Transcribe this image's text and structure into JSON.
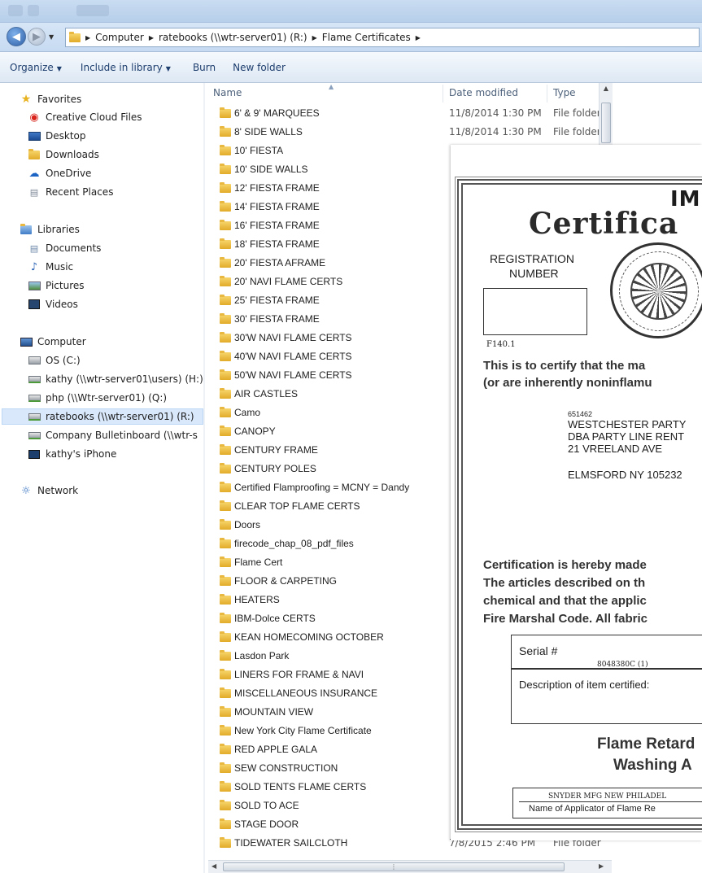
{
  "address_bar": {
    "crumbs": [
      "Computer",
      "ratebooks (\\\\wtr-server01) (R:)",
      "Flame Certificates"
    ]
  },
  "toolbar": {
    "organize": "Organize",
    "include_in_library": "Include in library",
    "burn": "Burn",
    "new_folder": "New folder"
  },
  "nav": {
    "favorites": {
      "label": "Favorites",
      "items": [
        "Creative Cloud Files",
        "Desktop",
        "Downloads",
        "OneDrive",
        "Recent Places"
      ]
    },
    "libraries": {
      "label": "Libraries",
      "items": [
        "Documents",
        "Music",
        "Pictures",
        "Videos"
      ]
    },
    "computer": {
      "label": "Computer",
      "items": [
        "OS (C:)",
        "kathy (\\\\wtr-server01\\users) (H:)",
        "php (\\\\Wtr-server01) (Q:)",
        "ratebooks (\\\\wtr-server01) (R:)",
        "Company Bulletinboard (\\\\wtr-s",
        "kathy's iPhone"
      ]
    },
    "network": {
      "label": "Network"
    }
  },
  "columns": {
    "name": "Name",
    "date_modified": "Date modified",
    "type": "Type"
  },
  "files": [
    {
      "name": "6' & 9' MARQUEES",
      "date": "11/8/2014 1:30 PM",
      "type": "File folder"
    },
    {
      "name": "8' SIDE WALLS",
      "date": "11/8/2014 1:30 PM",
      "type": "File folder"
    },
    {
      "name": "10' FIESTA",
      "date": "",
      "type": ""
    },
    {
      "name": "10' SIDE WALLS",
      "date": "",
      "type": ""
    },
    {
      "name": "12' FIESTA FRAME",
      "date": "",
      "type": ""
    },
    {
      "name": "14' FIESTA FRAME",
      "date": "",
      "type": ""
    },
    {
      "name": "16' FIESTA FRAME",
      "date": "",
      "type": ""
    },
    {
      "name": "18' FIESTA FRAME",
      "date": "",
      "type": ""
    },
    {
      "name": "20' FIESTA AFRAME",
      "date": "",
      "type": ""
    },
    {
      "name": "20' NAVI FLAME CERTS",
      "date": "",
      "type": ""
    },
    {
      "name": "25' FIESTA FRAME",
      "date": "",
      "type": ""
    },
    {
      "name": "30' FIESTA FRAME",
      "date": "",
      "type": ""
    },
    {
      "name": "30'W NAVI FLAME CERTS",
      "date": "",
      "type": ""
    },
    {
      "name": "40'W NAVI FLAME CERTS",
      "date": "",
      "type": ""
    },
    {
      "name": "50'W NAVI FLAME CERTS",
      "date": "",
      "type": ""
    },
    {
      "name": "AIR CASTLES",
      "date": "",
      "type": ""
    },
    {
      "name": "Camo",
      "date": "",
      "type": ""
    },
    {
      "name": "CANOPY",
      "date": "",
      "type": ""
    },
    {
      "name": "CENTURY FRAME",
      "date": "",
      "type": ""
    },
    {
      "name": "CENTURY POLES",
      "date": "",
      "type": ""
    },
    {
      "name": "Certified Flamproofing = MCNY = Dandy",
      "date": "",
      "type": ""
    },
    {
      "name": "CLEAR TOP FLAME CERTS",
      "date": "",
      "type": ""
    },
    {
      "name": "Doors",
      "date": "",
      "type": ""
    },
    {
      "name": "firecode_chap_08_pdf_files",
      "date": "",
      "type": ""
    },
    {
      "name": "Flame Cert",
      "date": "",
      "type": ""
    },
    {
      "name": "FLOOR & CARPETING",
      "date": "",
      "type": ""
    },
    {
      "name": "HEATERS",
      "date": "",
      "type": ""
    },
    {
      "name": "IBM-Dolce CERTS",
      "date": "",
      "type": ""
    },
    {
      "name": "KEAN HOMECOMING OCTOBER",
      "date": "",
      "type": ""
    },
    {
      "name": "Lasdon Park",
      "date": "",
      "type": ""
    },
    {
      "name": "LINERS FOR FRAME & NAVI",
      "date": "",
      "type": ""
    },
    {
      "name": "MISCELLANEOUS INSURANCE",
      "date": "",
      "type": ""
    },
    {
      "name": "MOUNTAIN VIEW",
      "date": "",
      "type": ""
    },
    {
      "name": "New York City Flame Certificate",
      "date": "",
      "type": ""
    },
    {
      "name": "RED APPLE GALA",
      "date": "",
      "type": ""
    },
    {
      "name": "SEW CONSTRUCTION",
      "date": "",
      "type": ""
    },
    {
      "name": "SOLD TENTS FLAME CERTS",
      "date": "",
      "type": ""
    },
    {
      "name": "SOLD TO ACE",
      "date": "",
      "type": ""
    },
    {
      "name": "STAGE DOOR",
      "date": "",
      "type": ""
    },
    {
      "name": "TIDEWATER SAILCLOTH",
      "date": "7/8/2015 2:46 PM",
      "type": "File folder"
    }
  ],
  "certificate": {
    "title_imp": "IMP",
    "title": "Certifica",
    "registration_label_1": "REGISTRATION",
    "registration_label_2": "NUMBER",
    "registration_code": "F140.1",
    "certify_line_1": "This is to certify that the ma",
    "certify_line_2": "(or are inherently noninflamu",
    "account_no": "651462",
    "address_1": "WESTCHESTER PARTY",
    "address_2": "DBA PARTY LINE RENT",
    "address_3": "21 VREELAND AVE",
    "address_4": "ELMSFORD  NY  105232",
    "cert_para_1": "Certification is hereby made",
    "cert_para_2": "The articles described on th",
    "cert_para_3": "chemical and that the applic",
    "cert_para_4": "Fire Marshal Code. All fabric",
    "serial_label": "Serial #",
    "serial_value": "8048380C (1)",
    "description_label": "Description of item certified:",
    "flame_retard": "Flame Retard",
    "washing": "Washing A",
    "applicator_name": "SNYDER MFG NEW PHILADEL",
    "applicator_label": "Name of Applicator of Flame Re"
  },
  "colors": {
    "selected_bg": "#d9e8fb",
    "link_text": "#1e3e6e",
    "folder_yellow": "#e2ab29"
  }
}
